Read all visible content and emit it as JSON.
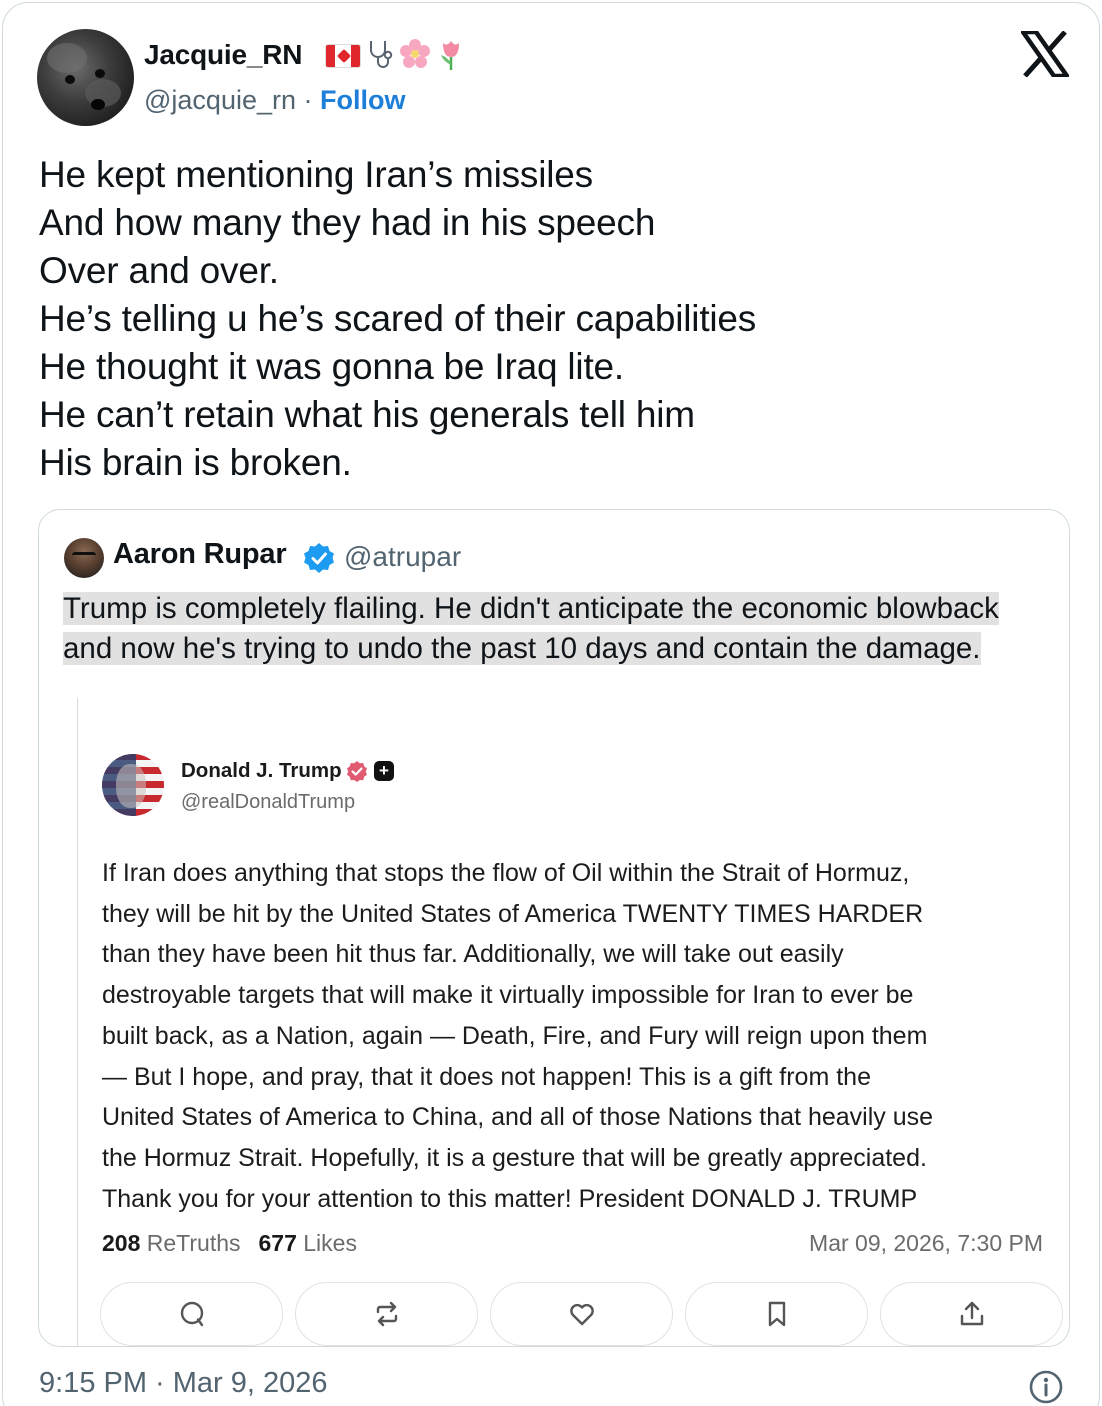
{
  "author": {
    "name": "Jacquie_RN",
    "handle": "@jacquie_rn",
    "separator": " · ",
    "follow_label": "Follow",
    "emojis": [
      "canadian-flag",
      "stethoscope",
      "cherry-blossom",
      "tulip"
    ]
  },
  "tweet": {
    "lines": [
      "He kept mentioning Iran’s missiles",
      "And how many they had in his speech",
      "Over and over.",
      "He’s telling u he’s scared of their capabilities",
      "He thought it was gonna be Iraq lite.",
      "He can’t retain what his generals tell him",
      "His brain is broken."
    ],
    "timestamp": "9:15 PM · Mar 9, 2026"
  },
  "quote": {
    "name": "Aaron Rupar",
    "handle": "@atrupar",
    "verified": true,
    "text": "Trump is completely flailing. He didn't anticipate the economic blowback and now he's trying to undo the past 10 days and contain the damage."
  },
  "embedded_post": {
    "name": "Donald J. Trump",
    "handle": "@realDonaldTrump",
    "body_lines": [
      "If Iran does anything that stops the flow of Oil within the Strait of Hormuz,",
      "they will be hit by the United States of America TWENTY TIMES HARDER",
      "than they have been hit thus far. Additionally, we will take out easily",
      "destroyable targets that will make it virtually impossible for Iran to ever be",
      "built back, as a Nation, again — Death, Fire, and Fury will reign upon them",
      "— But I hope, and pray, that it does not happen! This is a gift from the",
      "United States of America to China, and all of those Nations that heavily use",
      "the Hormuz Strait. Hopefully, it is a gesture that will be greatly appreciated.",
      "Thank you for your attention to this matter! President DONALD J. TRUMP"
    ],
    "retruths_count": "208",
    "retruths_label": "ReTruths",
    "likes_count": "677",
    "likes_label": "Likes",
    "date": "Mar 09, 2026, 7:30 PM",
    "actions": [
      "reply-icon",
      "retruth-icon",
      "like-icon",
      "bookmark-icon",
      "share-icon"
    ]
  },
  "colors": {
    "link_blue": "#1d7fd8",
    "verified_blue": "#1d9bf0",
    "muted_text": "#536471",
    "highlight": "#e1e1e1"
  }
}
